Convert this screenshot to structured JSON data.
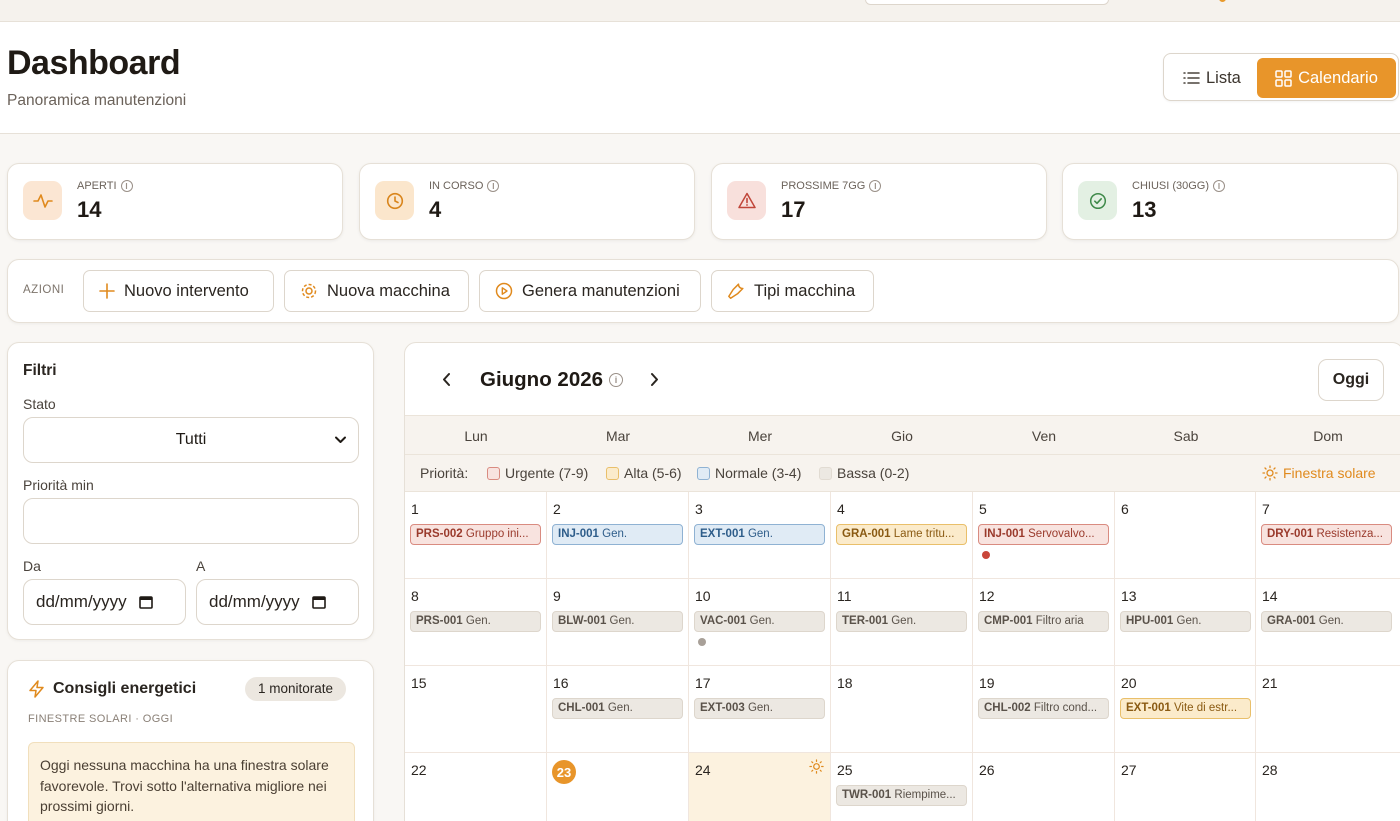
{
  "header": {
    "title": "Dashboard",
    "subtitle": "Panoramica manutenzioni",
    "view_list": "Lista",
    "view_calendar": "Calendario"
  },
  "stats": [
    {
      "label": "APERTI",
      "value": "14",
      "icon": "activity-icon",
      "bg": "#fbe6d3",
      "color": "#e08a1e"
    },
    {
      "label": "IN CORSO",
      "value": "4",
      "icon": "clock-icon",
      "bg": "#fbe6cc",
      "color": "#d9851c"
    },
    {
      "label": "PROSSIME 7GG",
      "value": "17",
      "icon": "warning-icon",
      "bg": "#f8e0dc",
      "color": "#c0463a"
    },
    {
      "label": "CHIUSI (30GG)",
      "value": "13",
      "icon": "check-circle-icon",
      "bg": "#e3f0e3",
      "color": "#3f8a4a"
    }
  ],
  "actions": {
    "label": "AZIONI",
    "buttons": [
      "Nuovo intervento",
      "Nuova macchina",
      "Genera manutenzioni",
      "Tipi macchina"
    ]
  },
  "filters": {
    "title": "Filtri",
    "state_label": "Stato",
    "state_value": "Tutti",
    "priority_label": "Priorità min",
    "from_label": "Da",
    "to_label": "A",
    "date_placeholder": "dd/mm/yyyy"
  },
  "energy": {
    "title": "Consigli energetici",
    "badge": "1 monitorate",
    "subtitle": "FINESTRE SOLARI · OGGI",
    "message": "Oggi nessuna macchina ha una finestra solare favorevole. Trovi sotto l'alternativa migliore nei prossimi giorni."
  },
  "calendar": {
    "month": "Giugno 2026",
    "today_button": "Oggi",
    "weekdays": [
      "Lun",
      "Mar",
      "Mer",
      "Gio",
      "Ven",
      "Sab",
      "Dom"
    ],
    "legend_label": "Priorità:",
    "legend": [
      {
        "label": "Urgente (7-9)",
        "level": "urgent"
      },
      {
        "label": "Alta (5-6)",
        "level": "high"
      },
      {
        "label": "Normale (3-4)",
        "level": "normal"
      },
      {
        "label": "Bassa (0-2)",
        "level": "low"
      }
    ],
    "solar_window": "Finestra solare",
    "weeks": [
      [
        {
          "day": "1",
          "event": {
            "code": "PRS-002",
            "text": "Gruppo ini...",
            "level": "urgent"
          }
        },
        {
          "day": "2",
          "event": {
            "code": "INJ-001",
            "text": "Gen.",
            "level": "normal"
          }
        },
        {
          "day": "3",
          "event": {
            "code": "EXT-001",
            "text": "Gen.",
            "level": "normal"
          }
        },
        {
          "day": "4",
          "event": {
            "code": "GRA-001",
            "text": "Lame tritu...",
            "level": "high"
          }
        },
        {
          "day": "5",
          "event": {
            "code": "INJ-001",
            "text": "Servovalvo...",
            "level": "urgent"
          },
          "dot": "#c9463a"
        },
        {
          "day": "6"
        },
        {
          "day": "7",
          "event": {
            "code": "DRY-001",
            "text": "Resistenza...",
            "level": "urgent"
          }
        }
      ],
      [
        {
          "day": "8",
          "event": {
            "code": "PRS-001",
            "text": "Gen.",
            "level": "low"
          }
        },
        {
          "day": "9",
          "event": {
            "code": "BLW-001",
            "text": "Gen.",
            "level": "low"
          }
        },
        {
          "day": "10",
          "event": {
            "code": "VAC-001",
            "text": "Gen.",
            "level": "low"
          },
          "dot": "#a8a098"
        },
        {
          "day": "11",
          "event": {
            "code": "TER-001",
            "text": "Gen.",
            "level": "low"
          }
        },
        {
          "day": "12",
          "event": {
            "code": "CMP-001",
            "text": "Filtro aria",
            "level": "low"
          }
        },
        {
          "day": "13",
          "event": {
            "code": "HPU-001",
            "text": "Gen.",
            "level": "low"
          }
        },
        {
          "day": "14",
          "event": {
            "code": "GRA-001",
            "text": "Gen.",
            "level": "low"
          }
        }
      ],
      [
        {
          "day": "15"
        },
        {
          "day": "16",
          "event": {
            "code": "CHL-001",
            "text": "Gen.",
            "level": "low"
          }
        },
        {
          "day": "17",
          "event": {
            "code": "EXT-003",
            "text": "Gen.",
            "level": "low"
          }
        },
        {
          "day": "18"
        },
        {
          "day": "19",
          "event": {
            "code": "CHL-002",
            "text": "Filtro cond...",
            "level": "low"
          }
        },
        {
          "day": "20",
          "event": {
            "code": "EXT-001",
            "text": "Vite di estr...",
            "level": "high"
          }
        },
        {
          "day": "21"
        }
      ],
      [
        {
          "day": "22"
        },
        {
          "day": "23",
          "today": true
        },
        {
          "day": "24",
          "solar": true
        },
        {
          "day": "25",
          "event": {
            "code": "TWR-001",
            "text": "Riempime...",
            "level": "low"
          }
        },
        {
          "day": "26"
        },
        {
          "day": "27"
        },
        {
          "day": "28"
        }
      ]
    ]
  }
}
